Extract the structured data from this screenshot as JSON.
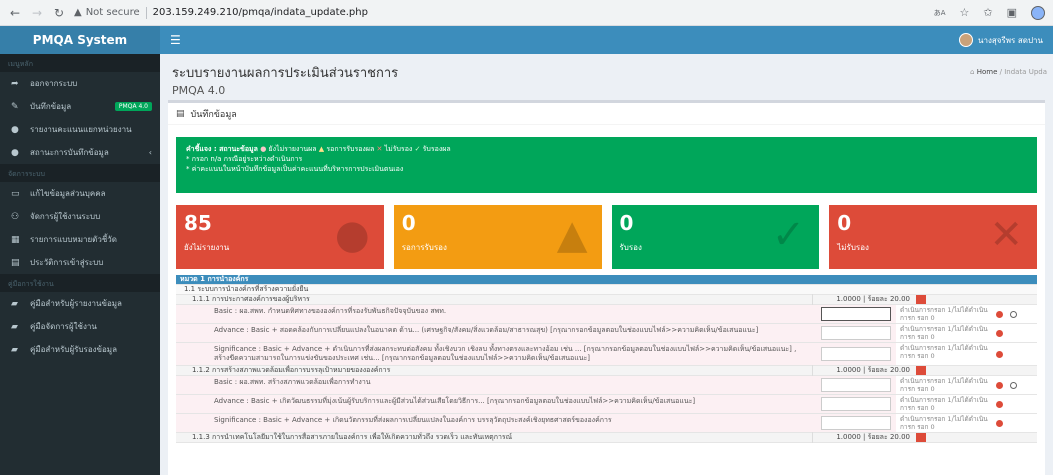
{
  "browser": {
    "not_secure": "Not secure",
    "url": "203.159.249.210/pmqa/indata_update.php"
  },
  "app": {
    "logo": "PMQA System",
    "user": "นางสุจรีพร สดปาน"
  },
  "sidebar": {
    "header1": "เมนูหลัก",
    "items": [
      {
        "icon": "logout-icon",
        "label": "ออกจากระบบ"
      },
      {
        "icon": "edit-icon",
        "label": "บันทึกข้อมูล",
        "badge": "PMQA 4.0"
      },
      {
        "icon": "report-icon",
        "label": "รายงานคะแนนแยกหน่วยงาน"
      },
      {
        "icon": "status-icon",
        "label": "สถานะการบันทึกข้อมูล"
      }
    ],
    "header2": "จัดการระบบ",
    "items2": [
      {
        "icon": "user-card-icon",
        "label": "แก้ไขข้อมูลส่วนบุคคล"
      },
      {
        "icon": "users-icon",
        "label": "จัดการผู้ใช้งานระบบ"
      },
      {
        "icon": "list-icon",
        "label": "รายการแบบหมายตัวชี้วัด"
      },
      {
        "icon": "calendar-icon",
        "label": "ประวัติการเข้าสู่ระบบ"
      }
    ],
    "header3": "คู่มือการใช้งาน",
    "items3": [
      {
        "icon": "book-icon",
        "label": "คู่มือสำหรับผู้รายงานข้อมูล"
      },
      {
        "icon": "book-icon",
        "label": "คู่มือจัดการผู้ใช้งาน"
      },
      {
        "icon": "book-icon",
        "label": "คู่มือสำหรับผู้รับรองข้อมูล"
      }
    ]
  },
  "page": {
    "title": "ระบบรายงานผลการประเมินส่วนราชการ",
    "subtitle": "PMQA 4.0",
    "breadcrumb_home": "Home",
    "breadcrumb_current": "Indata Upda",
    "box_title": "บันทึกข้อมูล"
  },
  "alert": {
    "line1_label": "คำชี้แจง : สถานะข้อมูล",
    "status1": "ยังไม่รายงานผล",
    "status2": "รอการรับรองผล",
    "status3": "ไม่รับรอง",
    "status4": "รับรองผล",
    "line2": "* กรอก n/a กรณีอยู่ระหว่างดำเนินการ",
    "line3": "* ค่าคะแนนในหน้าบันทึกข้อมูลเป็นค่าคะแนนที่บริหารการประเมินตนเอง"
  },
  "tiles": [
    {
      "value": "85",
      "label": "ยังไม่รายงาน",
      "color": "#dd4b39",
      "icon": "alert-circle-icon"
    },
    {
      "value": "0",
      "label": "รอการรับรอง",
      "color": "#f39c12",
      "icon": "warning-triangle-icon"
    },
    {
      "value": "0",
      "label": "รับรอง",
      "color": "#00a65a",
      "icon": "check-icon"
    },
    {
      "value": "0",
      "label": "ไม่รับรอง",
      "color": "#dd4b39",
      "icon": "x-icon"
    }
  ],
  "table": {
    "section": "หมวด 1 การนำองค์กร",
    "sub1": "1.1 ระบบการนำองค์กรที่สร้างความยั่งยืน",
    "q111": "1.1.1 การประกาศองค์การของผู้บริหาร",
    "q111_score": "1.0000 | ร้อยละ 20.00",
    "q112": "1.1.2 การสร้างสภาพแวดล้อมเพื่อการบรรลุเป้าหมายของงองค์การ",
    "q112_score": "1.0000 | ร้อยละ 20.00",
    "q113": "1.1.3 การนำเทคโนโลยีมาใช้ในการสื่อสารภายในองค์การ เพื่อให้เกิดความทั่วถึง รวดเร็ว และทันเหตุการณ์",
    "q113_score": "1.0000 | ร้อยละ 20.00",
    "rows": [
      {
        "text": "Basic : ผอ.สพท. กำหนดทิศทางขององค์การที่รองรับพันธกิจปัจจุบันของ สพท.",
        "note": "ดำเนินการกรอก 1/ไม่ได้ดำเนินการก รอก 0"
      },
      {
        "text": "Advance : Basic + สอดคล้องกับการเปลี่ยนแปลงในอนาคต ด้าน... (เศรษฐกิจ/สังคม/สิ่งแวดล้อม/สาธารณสุข) [กรุณากรอกข้อมูลตอบในช่องแบบไฟล์>>ความคิดเห็น/ข้อเสนอแนะ]",
        "note": "ดำเนินการกรอก 1/ไม่ได้ดำเนินการก รอก 0"
      },
      {
        "text": "Significance : Basic + Advance + ดำเนินการที่ส่งผลกระทบต่อสังคม ทั้งเชิงบวก เชิงลบ ทั้งทางตรงและทางอ้อม เช่น ... [กรุณากรอกข้อมูลตอบในช่องแบบไฟล์>>ความคิดเห็น/ข้อเสนอแนะ] , สร้างขีดความสามารถในการแข่งขันของประเทศ เช่น... [กรุณากรอกข้อมูลตอบในช่องแบบไฟล์>>ความคิดเห็น/ข้อเสนอแนะ]",
        "note": "ดำเนินการกรอก 1/ไม่ได้ดำเนินการก รอก 0"
      },
      {
        "text": "Basic : ผอ.สพท. สร้างสภาพแวดล้อมเพื่อการทำงาน",
        "note": "ดำเนินการกรอก 1/ไม่ได้ดำเนินการก รอก 0"
      },
      {
        "text": "Advance : Basic + เกิดวัฒนธรรมที่มุ่งเน้นผู้รับบริการและผู้มีส่วนได้ส่วนเสียโดยวิธีการ... [กรุณากรอกข้อมูลตอบในช่องแบบไฟล์>>ความคิดเห็น/ข้อเสนอแนะ]",
        "note": "ดำเนินการกรอก 1/ไม่ได้ดำเนินการก รอก 0"
      },
      {
        "text": "Significance : Basic + Advance + เกิดนวัตกรรมที่ส่งผลการเปลี่ยนแปลงในองค์การ บรรลุวัตถุประสงค์เชิงยุทธศาสตร์ขององค์การ",
        "note": "ดำเนินการกรอก 1/ไม่ได้ดำเนินการก รอก 0"
      }
    ]
  }
}
